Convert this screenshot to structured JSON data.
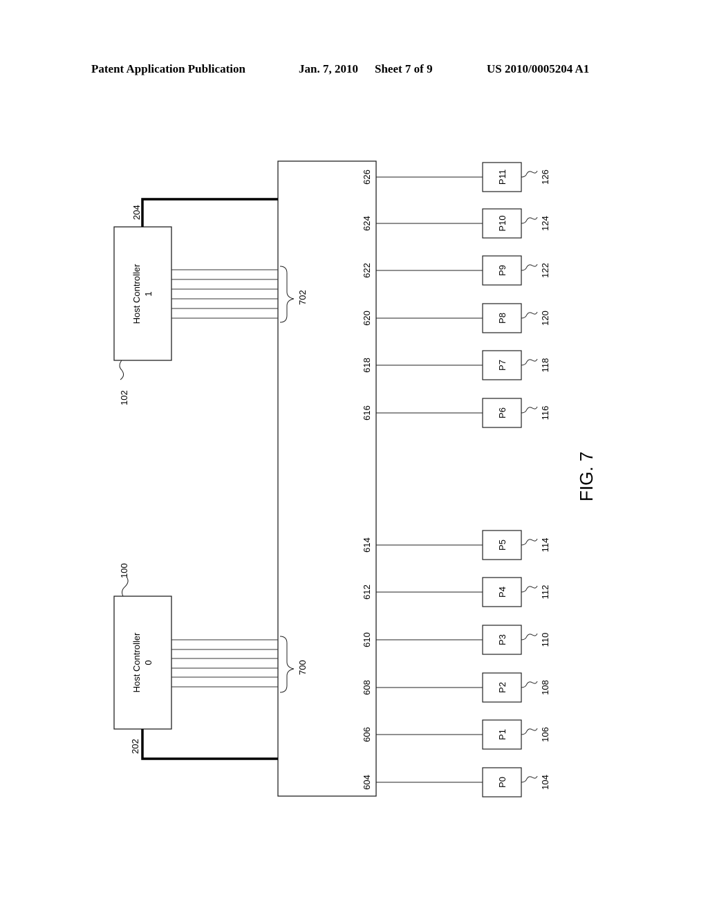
{
  "header": {
    "publication": "Patent Application Publication",
    "date": "Jan. 7, 2010",
    "sheet": "Sheet 7 of 9",
    "number": "US 2010/0005204 A1"
  },
  "figure": {
    "label": "FIG. 7",
    "host_controllers": [
      {
        "name": "Host Controller",
        "index": "1",
        "ref": "102",
        "link_ref": "204",
        "bus_ref": "702"
      },
      {
        "name": "Host Controller",
        "index": "0",
        "ref": "100",
        "link_ref": "202",
        "bus_ref": "700"
      }
    ],
    "hub_ports": [
      {
        "port_ref": "626",
        "device": "P11",
        "device_ref": "126"
      },
      {
        "port_ref": "624",
        "device": "P10",
        "device_ref": "124"
      },
      {
        "port_ref": "622",
        "device": "P9",
        "device_ref": "122"
      },
      {
        "port_ref": "620",
        "device": "P8",
        "device_ref": "120"
      },
      {
        "port_ref": "618",
        "device": "P7",
        "device_ref": "118"
      },
      {
        "port_ref": "616",
        "device": "P6",
        "device_ref": "116"
      },
      {
        "port_ref": "614",
        "device": "P5",
        "device_ref": "114"
      },
      {
        "port_ref": "612",
        "device": "P4",
        "device_ref": "112"
      },
      {
        "port_ref": "610",
        "device": "P3",
        "device_ref": "110"
      },
      {
        "port_ref": "608",
        "device": "P2",
        "device_ref": "108"
      },
      {
        "port_ref": "606",
        "device": "P1",
        "device_ref": "106"
      },
      {
        "port_ref": "604",
        "device": "P0",
        "device_ref": "104"
      }
    ],
    "bus_line_count": 6
  }
}
